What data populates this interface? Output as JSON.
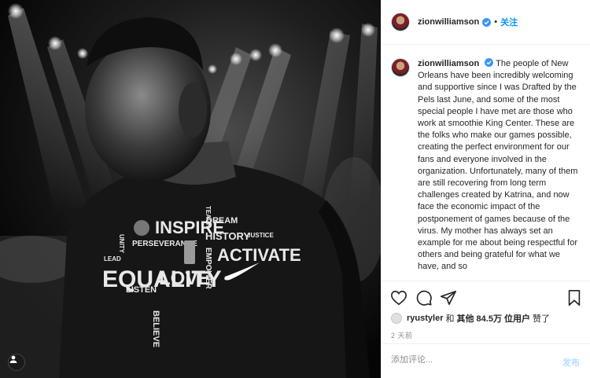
{
  "post": {
    "username": "zionwilliamson",
    "follow_label": "关注",
    "dot": "•",
    "caption": "The people of New Orleans have been incredibly welcoming and supportive since I was Drafted by the Pels last June, and some of the most special people I have met are those who work at smoothie King Center. These are the folks who make our games possible, creating the perfect environment for our fans and everyone involved in the organization. Unfortunately, many of them are still recovering from long term challenges created by Katrina, and now face the economic impact of the postponement of games because of the virus. My mother has always set an example for me about being respectful for others and being grateful for what we have, and so",
    "shirt_text": {
      "inspire": "INSPIRE",
      "equality": "EQUALITY",
      "love": "LOVE",
      "activate": "ACTIVATE",
      "history": "HISTORY",
      "dream": "DREAM",
      "teach": "TEACH",
      "perseverance": "PERSEVERANCE",
      "empower": "EMPOWER",
      "listen": "LISTEN",
      "believe": "BELIEVE",
      "justice": "JUSTICE",
      "lead": "LEAD",
      "unity": "UNITY"
    }
  },
  "likes": {
    "liker": "ryustyler",
    "and_text": "和",
    "others_text": "其他 84.5万 位用户",
    "liked_text": "赞了"
  },
  "timestamp": "2 天前",
  "comment": {
    "placeholder": "添加评论...",
    "post_label": "发布"
  },
  "colors": {
    "accent": "#0095f6",
    "post_disabled": "#b2dffc",
    "verified": "#3897f0"
  },
  "icons": [
    "user-tag-icon",
    "verified-badge-icon",
    "heart-icon",
    "comment-icon",
    "share-icon",
    "bookmark-icon"
  ]
}
